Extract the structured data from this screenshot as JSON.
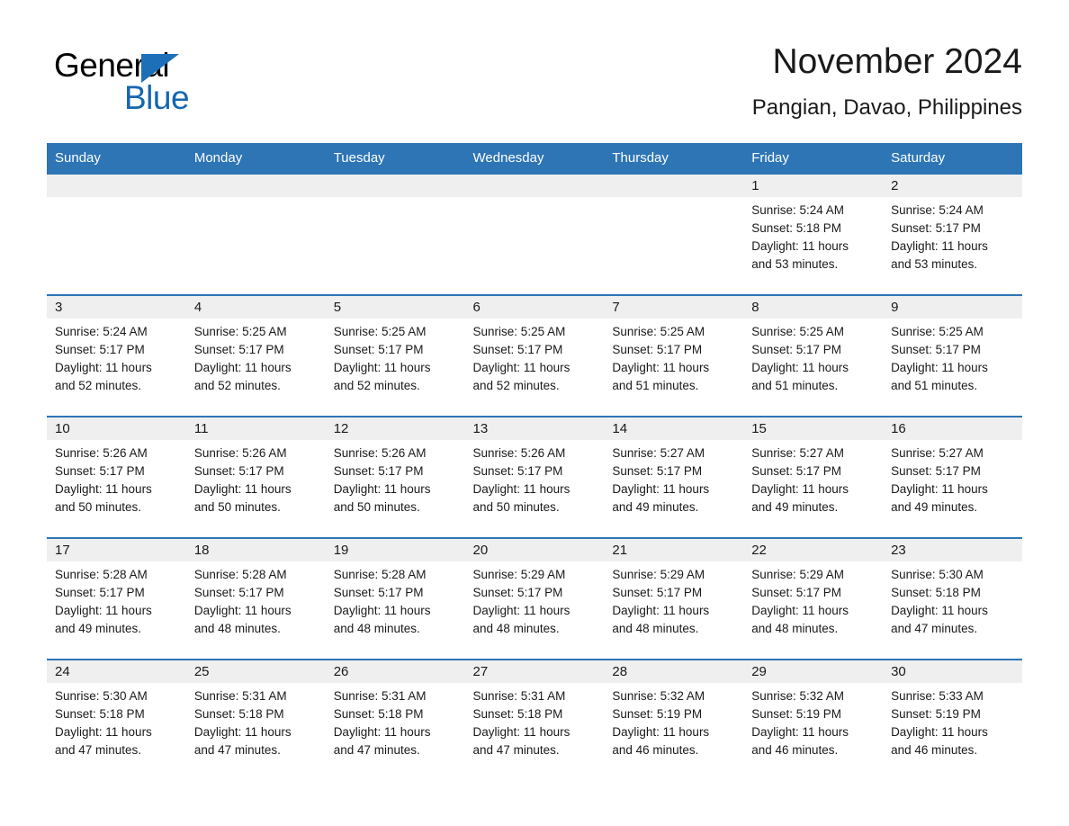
{
  "brand": {
    "name_part1": "General",
    "name_part2": "Blue",
    "triangle_icon": "triangle-right-icon",
    "color_black": "#000000",
    "color_blue": "#1566b0"
  },
  "header": {
    "title": "November 2024",
    "subtitle": "Pangian, Davao, Philippines"
  },
  "theme": {
    "header_blue": "#2e75b6",
    "day_band_gray": "#efefef",
    "text": "#1a1a1a",
    "page_background": "#ffffff"
  },
  "labels": {
    "sunrise_prefix": "Sunrise:",
    "sunset_prefix": "Sunset:",
    "daylight_prefix": "Daylight:"
  },
  "weekdays": [
    "Sunday",
    "Monday",
    "Tuesday",
    "Wednesday",
    "Thursday",
    "Friday",
    "Saturday"
  ],
  "weeks": [
    [
      {
        "blank": true
      },
      {
        "blank": true
      },
      {
        "blank": true
      },
      {
        "blank": true
      },
      {
        "blank": true
      },
      {
        "day": "1",
        "sunrise": "Sunrise: 5:24 AM",
        "sunset": "Sunset: 5:18 PM",
        "daylight_l1": "Daylight: 11 hours",
        "daylight_l2": "and 53 minutes."
      },
      {
        "day": "2",
        "sunrise": "Sunrise: 5:24 AM",
        "sunset": "Sunset: 5:17 PM",
        "daylight_l1": "Daylight: 11 hours",
        "daylight_l2": "and 53 minutes."
      }
    ],
    [
      {
        "day": "3",
        "sunrise": "Sunrise: 5:24 AM",
        "sunset": "Sunset: 5:17 PM",
        "daylight_l1": "Daylight: 11 hours",
        "daylight_l2": "and 52 minutes."
      },
      {
        "day": "4",
        "sunrise": "Sunrise: 5:25 AM",
        "sunset": "Sunset: 5:17 PM",
        "daylight_l1": "Daylight: 11 hours",
        "daylight_l2": "and 52 minutes."
      },
      {
        "day": "5",
        "sunrise": "Sunrise: 5:25 AM",
        "sunset": "Sunset: 5:17 PM",
        "daylight_l1": "Daylight: 11 hours",
        "daylight_l2": "and 52 minutes."
      },
      {
        "day": "6",
        "sunrise": "Sunrise: 5:25 AM",
        "sunset": "Sunset: 5:17 PM",
        "daylight_l1": "Daylight: 11 hours",
        "daylight_l2": "and 52 minutes."
      },
      {
        "day": "7",
        "sunrise": "Sunrise: 5:25 AM",
        "sunset": "Sunset: 5:17 PM",
        "daylight_l1": "Daylight: 11 hours",
        "daylight_l2": "and 51 minutes."
      },
      {
        "day": "8",
        "sunrise": "Sunrise: 5:25 AM",
        "sunset": "Sunset: 5:17 PM",
        "daylight_l1": "Daylight: 11 hours",
        "daylight_l2": "and 51 minutes."
      },
      {
        "day": "9",
        "sunrise": "Sunrise: 5:25 AM",
        "sunset": "Sunset: 5:17 PM",
        "daylight_l1": "Daylight: 11 hours",
        "daylight_l2": "and 51 minutes."
      }
    ],
    [
      {
        "day": "10",
        "sunrise": "Sunrise: 5:26 AM",
        "sunset": "Sunset: 5:17 PM",
        "daylight_l1": "Daylight: 11 hours",
        "daylight_l2": "and 50 minutes."
      },
      {
        "day": "11",
        "sunrise": "Sunrise: 5:26 AM",
        "sunset": "Sunset: 5:17 PM",
        "daylight_l1": "Daylight: 11 hours",
        "daylight_l2": "and 50 minutes."
      },
      {
        "day": "12",
        "sunrise": "Sunrise: 5:26 AM",
        "sunset": "Sunset: 5:17 PM",
        "daylight_l1": "Daylight: 11 hours",
        "daylight_l2": "and 50 minutes."
      },
      {
        "day": "13",
        "sunrise": "Sunrise: 5:26 AM",
        "sunset": "Sunset: 5:17 PM",
        "daylight_l1": "Daylight: 11 hours",
        "daylight_l2": "and 50 minutes."
      },
      {
        "day": "14",
        "sunrise": "Sunrise: 5:27 AM",
        "sunset": "Sunset: 5:17 PM",
        "daylight_l1": "Daylight: 11 hours",
        "daylight_l2": "and 49 minutes."
      },
      {
        "day": "15",
        "sunrise": "Sunrise: 5:27 AM",
        "sunset": "Sunset: 5:17 PM",
        "daylight_l1": "Daylight: 11 hours",
        "daylight_l2": "and 49 minutes."
      },
      {
        "day": "16",
        "sunrise": "Sunrise: 5:27 AM",
        "sunset": "Sunset: 5:17 PM",
        "daylight_l1": "Daylight: 11 hours",
        "daylight_l2": "and 49 minutes."
      }
    ],
    [
      {
        "day": "17",
        "sunrise": "Sunrise: 5:28 AM",
        "sunset": "Sunset: 5:17 PM",
        "daylight_l1": "Daylight: 11 hours",
        "daylight_l2": "and 49 minutes."
      },
      {
        "day": "18",
        "sunrise": "Sunrise: 5:28 AM",
        "sunset": "Sunset: 5:17 PM",
        "daylight_l1": "Daylight: 11 hours",
        "daylight_l2": "and 48 minutes."
      },
      {
        "day": "19",
        "sunrise": "Sunrise: 5:28 AM",
        "sunset": "Sunset: 5:17 PM",
        "daylight_l1": "Daylight: 11 hours",
        "daylight_l2": "and 48 minutes."
      },
      {
        "day": "20",
        "sunrise": "Sunrise: 5:29 AM",
        "sunset": "Sunset: 5:17 PM",
        "daylight_l1": "Daylight: 11 hours",
        "daylight_l2": "and 48 minutes."
      },
      {
        "day": "21",
        "sunrise": "Sunrise: 5:29 AM",
        "sunset": "Sunset: 5:17 PM",
        "daylight_l1": "Daylight: 11 hours",
        "daylight_l2": "and 48 minutes."
      },
      {
        "day": "22",
        "sunrise": "Sunrise: 5:29 AM",
        "sunset": "Sunset: 5:17 PM",
        "daylight_l1": "Daylight: 11 hours",
        "daylight_l2": "and 48 minutes."
      },
      {
        "day": "23",
        "sunrise": "Sunrise: 5:30 AM",
        "sunset": "Sunset: 5:18 PM",
        "daylight_l1": "Daylight: 11 hours",
        "daylight_l2": "and 47 minutes."
      }
    ],
    [
      {
        "day": "24",
        "sunrise": "Sunrise: 5:30 AM",
        "sunset": "Sunset: 5:18 PM",
        "daylight_l1": "Daylight: 11 hours",
        "daylight_l2": "and 47 minutes."
      },
      {
        "day": "25",
        "sunrise": "Sunrise: 5:31 AM",
        "sunset": "Sunset: 5:18 PM",
        "daylight_l1": "Daylight: 11 hours",
        "daylight_l2": "and 47 minutes."
      },
      {
        "day": "26",
        "sunrise": "Sunrise: 5:31 AM",
        "sunset": "Sunset: 5:18 PM",
        "daylight_l1": "Daylight: 11 hours",
        "daylight_l2": "and 47 minutes."
      },
      {
        "day": "27",
        "sunrise": "Sunrise: 5:31 AM",
        "sunset": "Sunset: 5:18 PM",
        "daylight_l1": "Daylight: 11 hours",
        "daylight_l2": "and 47 minutes."
      },
      {
        "day": "28",
        "sunrise": "Sunrise: 5:32 AM",
        "sunset": "Sunset: 5:19 PM",
        "daylight_l1": "Daylight: 11 hours",
        "daylight_l2": "and 46 minutes."
      },
      {
        "day": "29",
        "sunrise": "Sunrise: 5:32 AM",
        "sunset": "Sunset: 5:19 PM",
        "daylight_l1": "Daylight: 11 hours",
        "daylight_l2": "and 46 minutes."
      },
      {
        "day": "30",
        "sunrise": "Sunrise: 5:33 AM",
        "sunset": "Sunset: 5:19 PM",
        "daylight_l1": "Daylight: 11 hours",
        "daylight_l2": "and 46 minutes."
      }
    ]
  ]
}
